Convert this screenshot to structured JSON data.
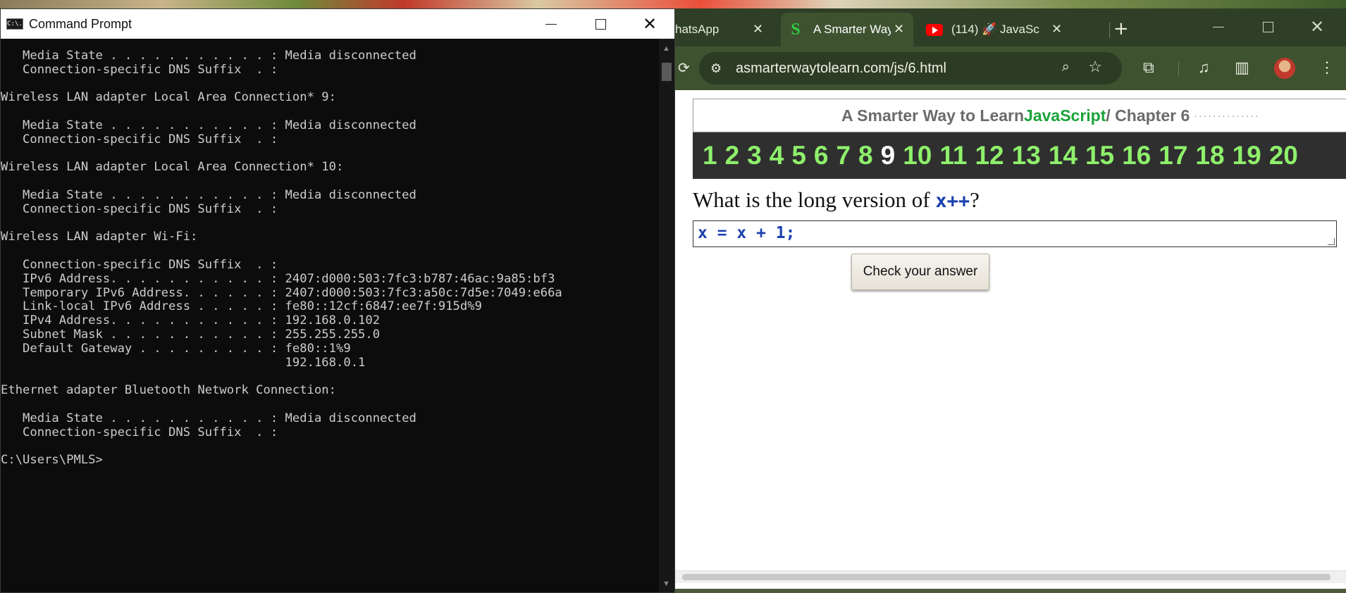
{
  "cmd": {
    "title": "Command Prompt",
    "icon": "cmd-icon",
    "icon_text": "C:\\.",
    "lines": [
      "   Media State . . . . . . . . . . . : Media disconnected",
      "   Connection-specific DNS Suffix  . :",
      "",
      "Wireless LAN adapter Local Area Connection* 9:",
      "",
      "   Media State . . . . . . . . . . . : Media disconnected",
      "   Connection-specific DNS Suffix  . :",
      "",
      "Wireless LAN adapter Local Area Connection* 10:",
      "",
      "   Media State . . . . . . . . . . . : Media disconnected",
      "   Connection-specific DNS Suffix  . :",
      "",
      "Wireless LAN adapter Wi-Fi:",
      "",
      "   Connection-specific DNS Suffix  . :",
      "   IPv6 Address. . . . . . . . . . . : 2407:d000:503:7fc3:b787:46ac:9a85:bf3",
      "   Temporary IPv6 Address. . . . . . : 2407:d000:503:7fc3:a50c:7d5e:7049:e66a",
      "   Link-local IPv6 Address . . . . . : fe80::12cf:6847:ee7f:915d%9",
      "   IPv4 Address. . . . . . . . . . . : 192.168.0.102",
      "   Subnet Mask . . . . . . . . . . . : 255.255.255.0",
      "   Default Gateway . . . . . . . . . : fe80::1%9",
      "                                       192.168.0.1",
      "",
      "Ethernet adapter Bluetooth Network Connection:",
      "",
      "   Media State . . . . . . . . . . . : Media disconnected",
      "   Connection-specific DNS Suffix  . :",
      "",
      "C:\\Users\\PMLS>"
    ]
  },
  "browser": {
    "tabs": [
      {
        "label": "WhatsApp",
        "visible_label": "hatsApp",
        "favicon": "whatsapp-icon",
        "active": false
      },
      {
        "label": "A Smarter Way t",
        "favicon": "s-favicon-icon",
        "active": true
      },
      {
        "label": "(114) 🚀 JavaSc",
        "favicon": "youtube-icon",
        "active": false
      }
    ],
    "url": "asmarterwaytolearn.com/js/6.html",
    "icons": {
      "site_info": "tune-icon",
      "zoom": "zoom-icon",
      "bookmark": "star-icon",
      "extensions": "puzzle-icon",
      "media": "media-queue-icon",
      "side_panel": "side-panel-icon",
      "menu": "kebab-menu-icon"
    },
    "colors": {
      "frame": "#2f3f27",
      "toolbar": "#3e5230"
    }
  },
  "page": {
    "header_base": "A Smarter Way to Learn ",
    "header_js": "JavaScript",
    "header_rest": " / Chapter 6",
    "header_dots": "··············",
    "chapters": [
      "1",
      "2",
      "3",
      "4",
      "5",
      "6",
      "7",
      "8",
      "9",
      "10",
      "11",
      "12",
      "13",
      "14",
      "15",
      "16",
      "17",
      "18",
      "19",
      "20"
    ],
    "current_chapter": "9",
    "question_prefix": "What is the long version of ",
    "question_code": "x++",
    "question_suffix": "?",
    "answer_value": "x = x + 1;",
    "check_button": "Check your answer",
    "colors": {
      "chapter_num": "#8ef06b",
      "chapter_bar": "#2f2f2f",
      "js_green": "#1aa33a",
      "code_blue": "#1c3fb0"
    }
  }
}
